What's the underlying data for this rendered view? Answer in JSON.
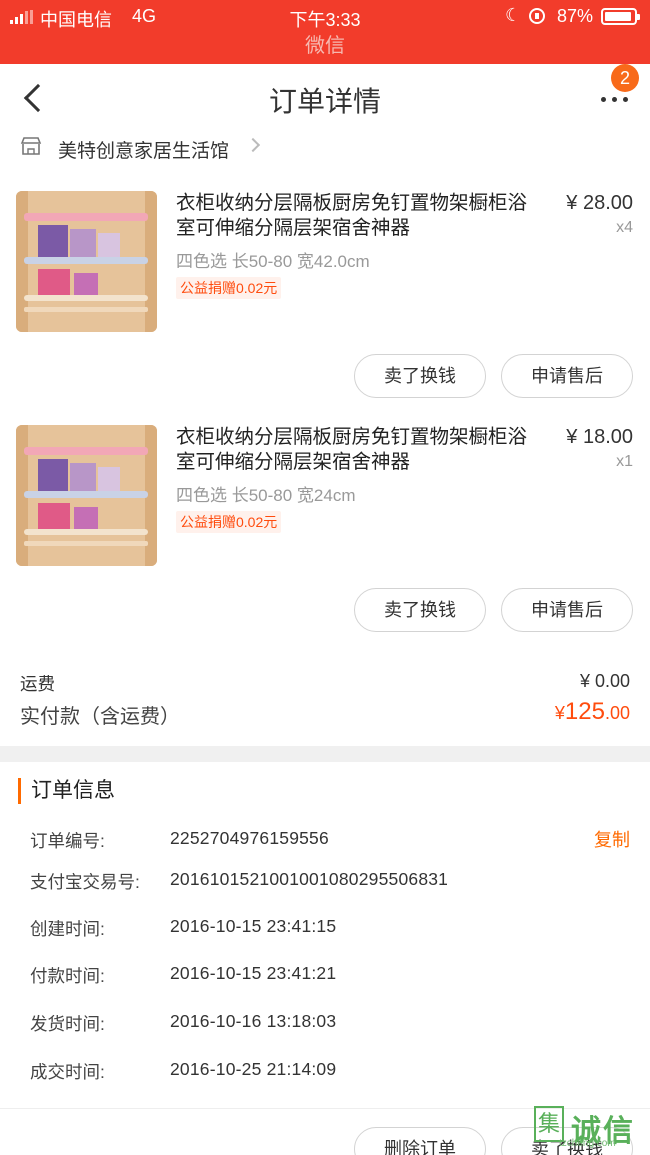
{
  "status_bar": {
    "carrier": "中国电信",
    "network": "4G",
    "time": "下午3:33",
    "battery": "87%"
  },
  "app_bar": {
    "title": "微信"
  },
  "nav": {
    "title": "订单详情",
    "badge": "2"
  },
  "shop": {
    "name": "美特创意家居生活馆"
  },
  "items": [
    {
      "name": "衣柜收纳分层隔板厨房免钉置物架橱柜浴室可伸缩分隔层架宿舍神器",
      "price": "¥ 28.00",
      "qty": "x4",
      "sku": "四色选 长50-80 宽42.0cm",
      "tag": "公益捐赠0.02元",
      "btn_sell": "卖了换钱",
      "btn_after_sale": "申请售后"
    },
    {
      "name": "衣柜收纳分层隔板厨房免钉置物架橱柜浴室可伸缩分隔层架宿舍神器",
      "price": "¥ 18.00",
      "qty": "x1",
      "sku": "四色选 长50-80 宽24cm",
      "tag": "公益捐赠0.02元",
      "btn_sell": "卖了换钱",
      "btn_after_sale": "申请售后"
    }
  ],
  "totals": {
    "shipping_label": "运费",
    "shipping_value": "¥ 0.00",
    "paid_label": "实付款（含运费）",
    "paid_currency": "¥",
    "paid_integer": "125",
    "paid_decimal": ".00"
  },
  "order_info": {
    "title": "订单信息",
    "copy_label": "复制",
    "rows": [
      {
        "label": "订单编号:",
        "value": "2252704976159556"
      },
      {
        "label": "支付宝交易号:",
        "value": "2016101521001001080295506831"
      },
      {
        "label": "创建时间:",
        "value": "2016-10-15 23:41:15"
      },
      {
        "label": "付款时间:",
        "value": "2016-10-15 23:41:21"
      },
      {
        "label": "发货时间:",
        "value": "2016-10-16 13:18:03"
      },
      {
        "label": "成交时间:",
        "value": "2016-10-25 21:14:09"
      }
    ]
  },
  "bottom_bar": {
    "delete_order": "删除订单",
    "sell": "卖了换钱"
  },
  "watermark": {
    "box_char": "集",
    "text": "诚信",
    "url": "tzcheng.com"
  },
  "colors": {
    "status_red": "#f23c2b",
    "accent_orange": "#ff4c0e",
    "badge_orange": "#f86a1a"
  }
}
